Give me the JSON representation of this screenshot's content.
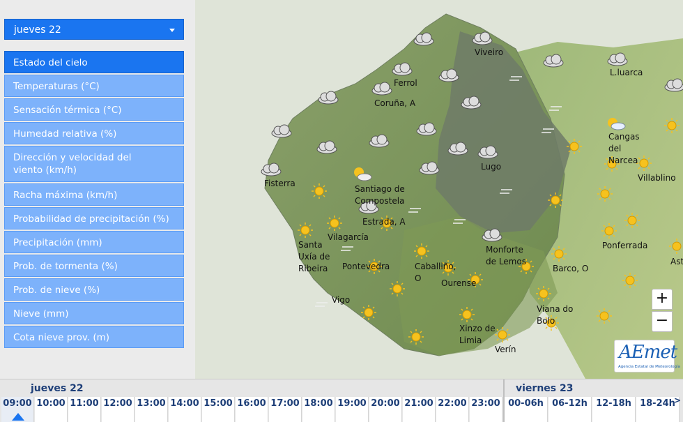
{
  "selector": {
    "day": "jueves 22"
  },
  "menu": [
    {
      "label": "Estado del cielo",
      "active": true
    },
    {
      "label": "Temperaturas (°C)"
    },
    {
      "label": "Sensación térmica (°C)"
    },
    {
      "label": "Humedad relativa (%)"
    },
    {
      "label": "Dirección y velocidad del viento (km/h)"
    },
    {
      "label": "Racha máxima (km/h)"
    },
    {
      "label": "Probabilidad de precipitación (%)"
    },
    {
      "label": "Precipitación (mm)"
    },
    {
      "label": "Prob. de tormenta (%)"
    },
    {
      "label": "Prob. de nieve (%)"
    },
    {
      "label": "Nieve (mm)"
    },
    {
      "label": "Cota nieve prov. (m)"
    }
  ],
  "places": [
    "Viveiro",
    "Ferrol",
    "Coruña, A",
    "Lugo",
    "Fisterra",
    "Santiago de Compostela",
    "Estrada, A",
    "Vilagarcía",
    "Santa Uxía de Ribeira",
    "Pontevedra",
    "Caballiño, O",
    "Ourense",
    "Monforte de Lemos",
    "Barco, O",
    "Vigo",
    "Viana do Bolo",
    "Xinzo de Limia",
    "Verín",
    "L.luarca",
    "Cangas del Narcea",
    "Villablino",
    "Ponferrada",
    "Ast"
  ],
  "map_controls": {
    "zoom_in": "+",
    "zoom_out": "−"
  },
  "logo": {
    "word": "AEmet",
    "subtitle": "Agencia Estatal de Meteorología"
  },
  "timeline": {
    "day1": "jueves 22",
    "day2": "viernes 23",
    "hours_day1": [
      "09:00",
      "10:00",
      "11:00",
      "12:00",
      "13:00",
      "14:00",
      "15:00",
      "16:00",
      "17:00",
      "18:00",
      "19:00",
      "20:00",
      "21:00",
      "22:00",
      "23:00"
    ],
    "periods_day2": [
      "00-06h",
      "06-12h",
      "12-18h",
      "18-24h"
    ],
    "next": ">"
  },
  "colors": {
    "accent": "#1a75f0",
    "menu": "#7db2fb",
    "timeline_text": "#1e3f78"
  },
  "icons": {
    "cloud": "cloud-icon",
    "sun": "sun-icon",
    "partly": "partly-cloudy-icon",
    "mist": "mist-icon"
  }
}
